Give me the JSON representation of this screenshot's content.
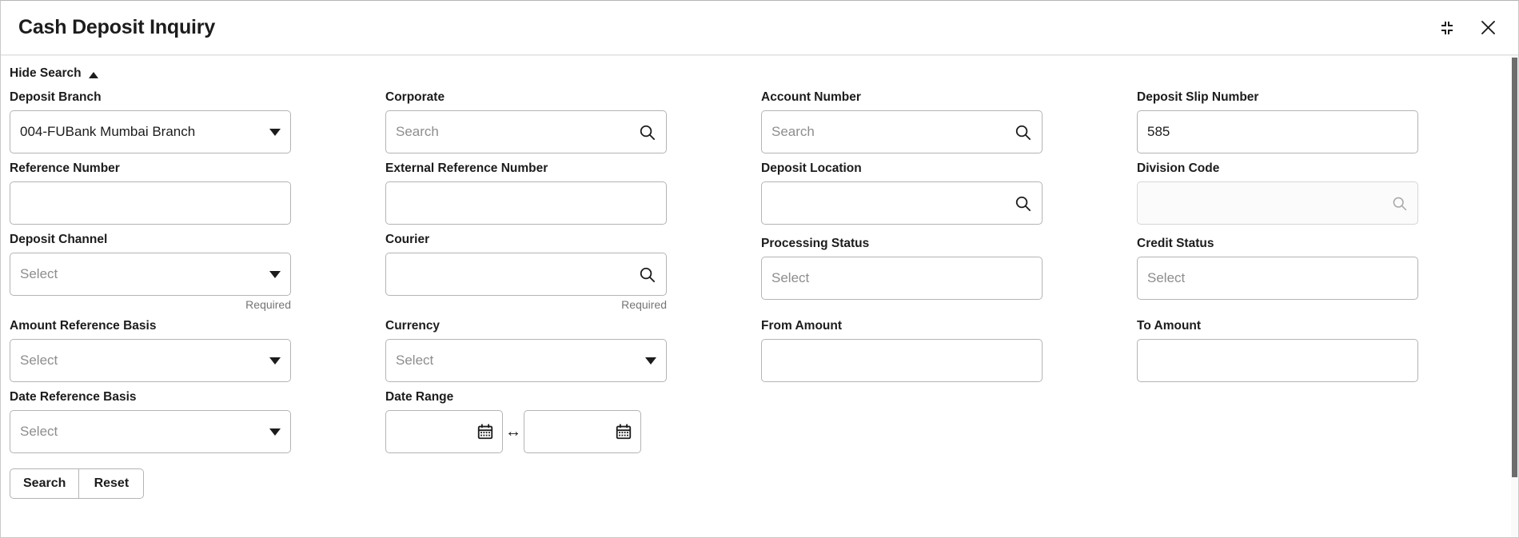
{
  "window": {
    "title": "Cash Deposit Inquiry",
    "minimize_icon": "collapse-corners-icon",
    "close_icon": "close-icon"
  },
  "search_panel": {
    "toggle_label": "Hide Search",
    "toggle_caret": "caret-up-icon",
    "fields": [
      {
        "name": "deposit-branch",
        "label": "Deposit Branch",
        "type": "select",
        "value": "004-FUBank Mumbai Branch",
        "placeholder": "",
        "disabled": false,
        "required_msg": ""
      },
      {
        "name": "corporate",
        "label": "Corporate",
        "type": "search",
        "value": "",
        "placeholder": "Search",
        "disabled": false,
        "required_msg": ""
      },
      {
        "name": "account-number",
        "label": "Account Number",
        "type": "search",
        "value": "",
        "placeholder": "Search",
        "disabled": false,
        "required_msg": ""
      },
      {
        "name": "deposit-slip-number",
        "label": "Deposit Slip Number",
        "type": "text",
        "value": "585",
        "placeholder": "",
        "disabled": false,
        "required_msg": ""
      },
      {
        "name": "reference-number",
        "label": "Reference Number",
        "type": "text",
        "value": "",
        "placeholder": "",
        "disabled": false,
        "required_msg": ""
      },
      {
        "name": "external-reference-number",
        "label": "External Reference Number",
        "type": "text",
        "value": "",
        "placeholder": "",
        "disabled": false,
        "required_msg": ""
      },
      {
        "name": "deposit-location",
        "label": "Deposit Location",
        "type": "lov",
        "value": "",
        "placeholder": "",
        "disabled": false,
        "required_msg": ""
      },
      {
        "name": "division-code",
        "label": "Division Code",
        "type": "lov",
        "value": "",
        "placeholder": "",
        "disabled": true,
        "required_msg": ""
      },
      {
        "name": "deposit-channel",
        "label": "Deposit Channel",
        "type": "select",
        "value": "",
        "placeholder": "Select",
        "disabled": false,
        "required_msg": "Required"
      },
      {
        "name": "courier",
        "label": "Courier",
        "type": "lov",
        "value": "",
        "placeholder": "",
        "disabled": false,
        "required_msg": "Required"
      },
      {
        "name": "processing-status",
        "label": "Processing Status",
        "type": "multiselect",
        "value": "",
        "placeholder": "Select",
        "disabled": false,
        "required_msg": ""
      },
      {
        "name": "credit-status",
        "label": "Credit Status",
        "type": "multiselect",
        "value": "",
        "placeholder": "Select",
        "disabled": false,
        "required_msg": ""
      },
      {
        "name": "amount-reference-basis",
        "label": "Amount Reference Basis",
        "type": "select",
        "value": "",
        "placeholder": "Select",
        "disabled": false,
        "required_msg": ""
      },
      {
        "name": "currency",
        "label": "Currency",
        "type": "select",
        "value": "",
        "placeholder": "Select",
        "disabled": false,
        "required_msg": ""
      },
      {
        "name": "from-amount",
        "label": "From Amount",
        "type": "text",
        "value": "",
        "placeholder": "",
        "disabled": false,
        "required_msg": ""
      },
      {
        "name": "to-amount",
        "label": "To Amount",
        "type": "text",
        "value": "",
        "placeholder": "",
        "disabled": false,
        "required_msg": ""
      },
      {
        "name": "date-reference-basis",
        "label": "Date Reference Basis",
        "type": "select",
        "value": "",
        "placeholder": "Select",
        "disabled": false,
        "required_msg": ""
      },
      {
        "name": "date-range",
        "label": "Date Range",
        "type": "daterange",
        "from_value": "",
        "to_value": "",
        "separator": "↔",
        "disabled": false,
        "required_msg": ""
      }
    ],
    "buttons": {
      "search_label": "Search",
      "reset_label": "Reset"
    }
  },
  "icons": {
    "search": "search-icon",
    "calendar": "calendar-icon"
  },
  "colors": {
    "border": "#b4b4b4",
    "text": "#1c1c1c",
    "placeholder": "#8d8d8d",
    "required": "#757575",
    "scrollbar": "#6d6d6d"
  }
}
